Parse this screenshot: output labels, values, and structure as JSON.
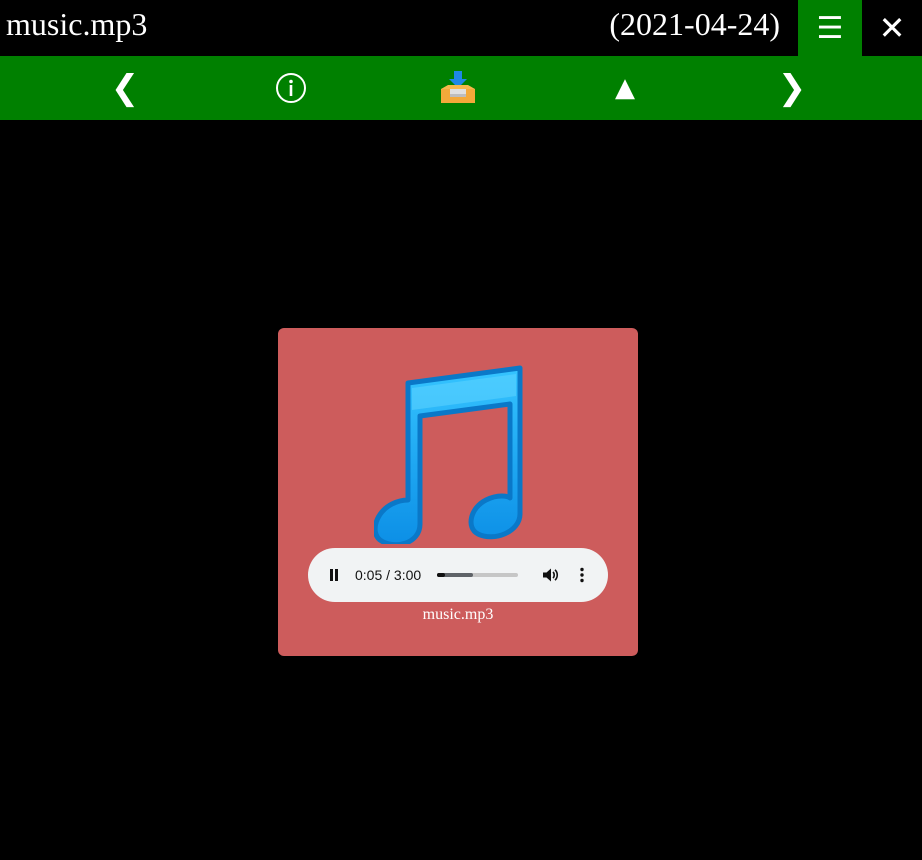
{
  "window": {
    "title": "music.mp3",
    "date": "(2021-04-24)",
    "menu_icon": "☰",
    "close_icon": "✕",
    "accent_color": "#008000"
  },
  "toolbar": {
    "prev_icon": "❮",
    "info_icon": "info-circle",
    "download_icon": "download-tray",
    "up_icon": "▲",
    "next_icon": "❯"
  },
  "media": {
    "thumbnail_icon": "music-note",
    "card_color": "#cd5c5c",
    "caption": "music.mp3",
    "player": {
      "state": "playing",
      "time": "0:05 / 3:00",
      "progress": 0.028,
      "buffered": 0.45
    }
  }
}
